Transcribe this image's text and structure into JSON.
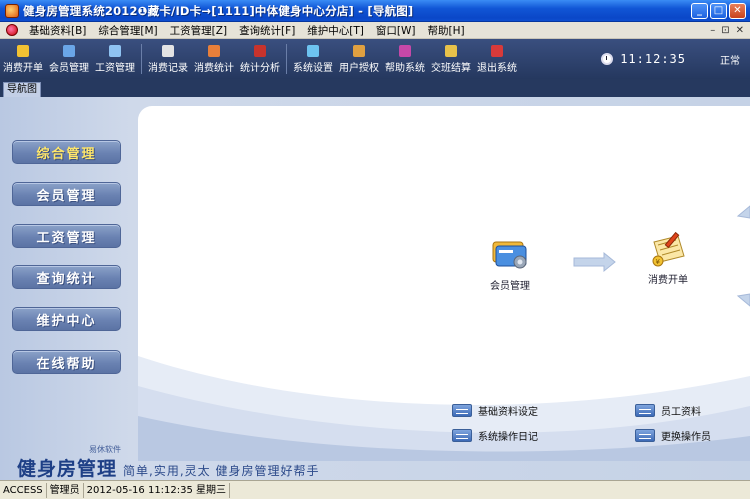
{
  "window": {
    "title": "健身房管理系统2012❶藏卡/ID卡→[1111]中体健身中心分店] - [导航图]",
    "minimize": "_",
    "maximize": "□",
    "close": "✕"
  },
  "menubar": {
    "items": [
      "基础资料[B]",
      "综合管理[M]",
      "工资管理[Z]",
      "查询统计[F]",
      "维护中心[T]",
      "窗口[W]",
      "帮助[H]"
    ],
    "right_controls": [
      "–",
      "⊡",
      "✕"
    ]
  },
  "toolbar": {
    "groups": [
      [
        {
          "label": "消费开单",
          "icon": "ticket-icon",
          "color": "#f2c232"
        },
        {
          "label": "会员管理",
          "icon": "member-icon",
          "color": "#6aa6e8"
        },
        {
          "label": "工资管理",
          "icon": "salary-icon",
          "color": "#8fc3f2"
        }
      ],
      [
        {
          "label": "消费记录",
          "icon": "record-icon",
          "color": "#e3e3e3"
        },
        {
          "label": "消费统计",
          "icon": "stats-icon",
          "color": "#e87f3a"
        },
        {
          "label": "统计分析",
          "icon": "analysis-icon",
          "color": "#c7332c"
        }
      ],
      [
        {
          "label": "系统设置",
          "icon": "settings-icon",
          "color": "#6dc3f0"
        },
        {
          "label": "用户授权",
          "icon": "user-auth-icon",
          "color": "#e0a040"
        },
        {
          "label": "帮助系统",
          "icon": "help-icon",
          "color": "#c548a8"
        },
        {
          "label": "交班结算",
          "icon": "shift-icon",
          "color": "#e8c24a"
        },
        {
          "label": "退出系统",
          "icon": "exit-icon",
          "color": "#d83a3a"
        }
      ]
    ],
    "clock": "11:12:35",
    "status": "正常"
  },
  "tabs": [
    "导航图"
  ],
  "sidebar": {
    "items": [
      "综合管理",
      "会员管理",
      "工资管理",
      "查询统计",
      "维护中心",
      "在线帮助"
    ],
    "active": 0
  },
  "navigation": {
    "nodes": [
      {
        "label": "会员管理",
        "icon": "member-card-icon"
      },
      {
        "label": "消费开单",
        "icon": "consume-bill-icon"
      }
    ],
    "links": [
      "基础资料设定",
      "员工资料",
      "系统操作日记",
      "更换操作员"
    ]
  },
  "branding": {
    "name": "健身房管理",
    "small": "易休软件",
    "slogan": "简单,实用,灵太   健身房管理好帮手"
  },
  "statusbar": {
    "db": "ACCESS",
    "user": "管理员",
    "datetime": "2012-05-16 11:12:35 星期三"
  },
  "colors": {
    "title_bar": "#0a47c8",
    "toolbar": "#2c3f68",
    "sidebar_button": "#6a82b2",
    "active_label": "#ffe76a",
    "brand": "#1e3f86"
  }
}
